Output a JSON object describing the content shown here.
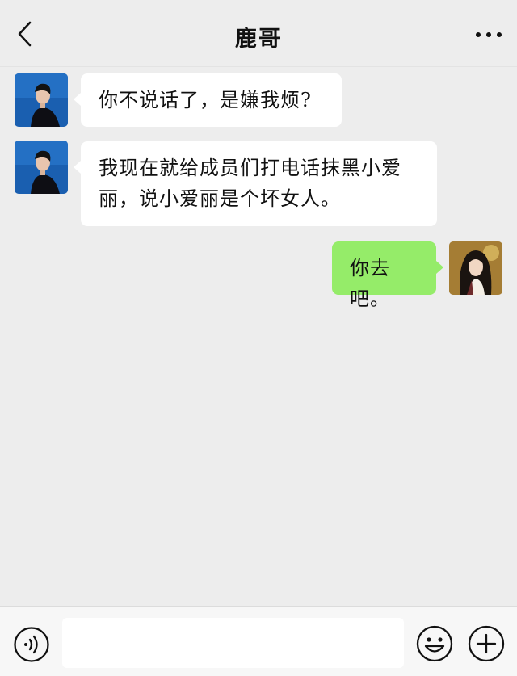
{
  "header": {
    "title": "鹿哥",
    "back_icon": "chevron-left-icon",
    "more_icon": "more-dots-icon"
  },
  "messages": [
    {
      "side": "left",
      "text": "你不说话了，是嫌我烦?"
    },
    {
      "side": "left",
      "text": "我现在就给成员们打电话抹黑小爱丽，说小爱丽是个坏女人。"
    },
    {
      "side": "right",
      "text": "你去吧。"
    }
  ],
  "footer": {
    "voice_icon": "voice-icon",
    "input_value": "",
    "emoji_icon": "emoji-icon",
    "plus_icon": "plus-icon"
  },
  "colors": {
    "background": "#ededed",
    "incoming_bubble": "#ffffff",
    "outgoing_bubble": "#95ec69",
    "avatar_blue": "#1a5fb0"
  }
}
